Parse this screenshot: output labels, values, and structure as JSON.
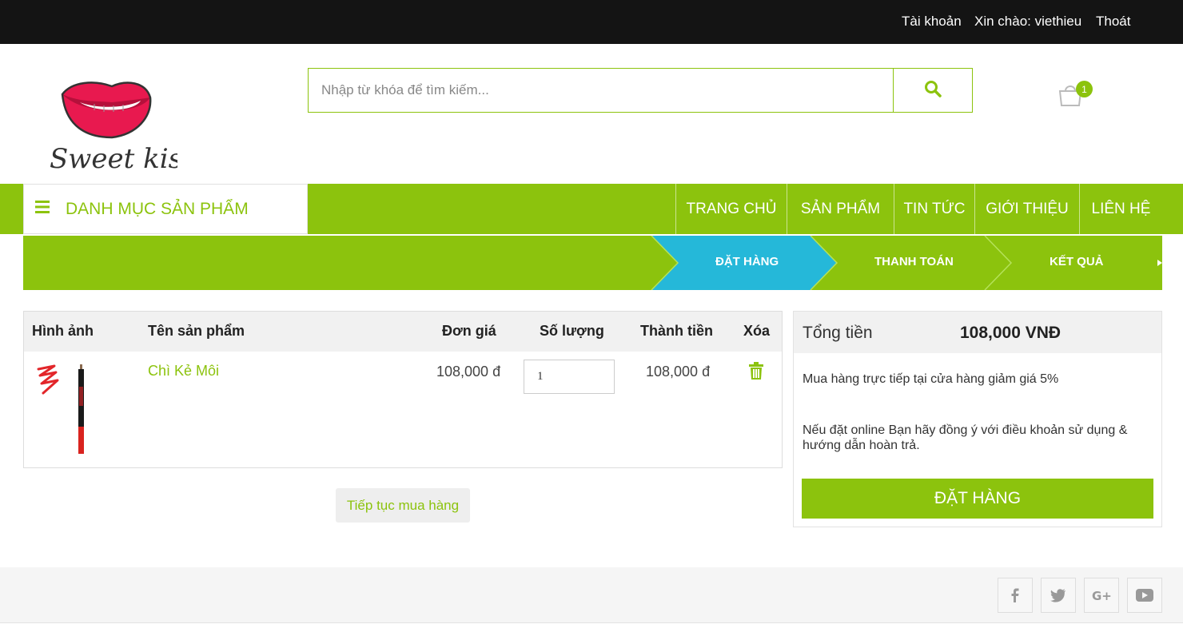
{
  "topbar": {
    "account": "Tài khoản",
    "greeting": "Xin chào: viethieu",
    "logout": "Thoát"
  },
  "header": {
    "logo_text": "Sweet kiss",
    "search_placeholder": "Nhập từ khóa để tìm kiếm...",
    "search_icon": "search-icon",
    "cart_icon": "shopping-bag-icon",
    "cart_count": "1"
  },
  "nav": {
    "category_label": "DANH MỤC SẢN PHẨM",
    "links": [
      "TRANG CHỦ",
      "SẢN PHẨM",
      "TIN TỨC",
      "GIỚI THIỆU",
      "LIÊN HỆ"
    ]
  },
  "steps": [
    "ĐẶT HÀNG",
    "THANH TOÁN",
    "KẾT QUẢ"
  ],
  "cart_table": {
    "headers": [
      "Hình ảnh",
      "Tên sản phẩm",
      "Đơn giá",
      "Số lượng",
      "Thành tiền",
      "Xóa"
    ],
    "items": [
      {
        "name": "Chì Kẻ Môi",
        "unit_price": "108,000 đ",
        "quantity": "1",
        "subtotal": "108,000 đ"
      }
    ]
  },
  "continue_button": "Tiếp tục mua hàng",
  "summary": {
    "title": "Tổng tiền",
    "total": "108,000 VNĐ",
    "note_store": "Mua hàng trực tiếp tại cửa hàng giảm giá 5%",
    "note_online": "Nếu đặt online Bạn hãy đồng ý với điều khoản sử dụng & hướng dẫn hoàn trả.",
    "order_button": "ĐẶT HÀNG"
  },
  "footer": {
    "social_icons": [
      "facebook-icon",
      "twitter-icon",
      "google-plus-icon",
      "youtube-icon"
    ]
  },
  "colors": {
    "brand_green": "#8cc30d",
    "active_step": "#25b8d9",
    "topbar": "#141414"
  }
}
